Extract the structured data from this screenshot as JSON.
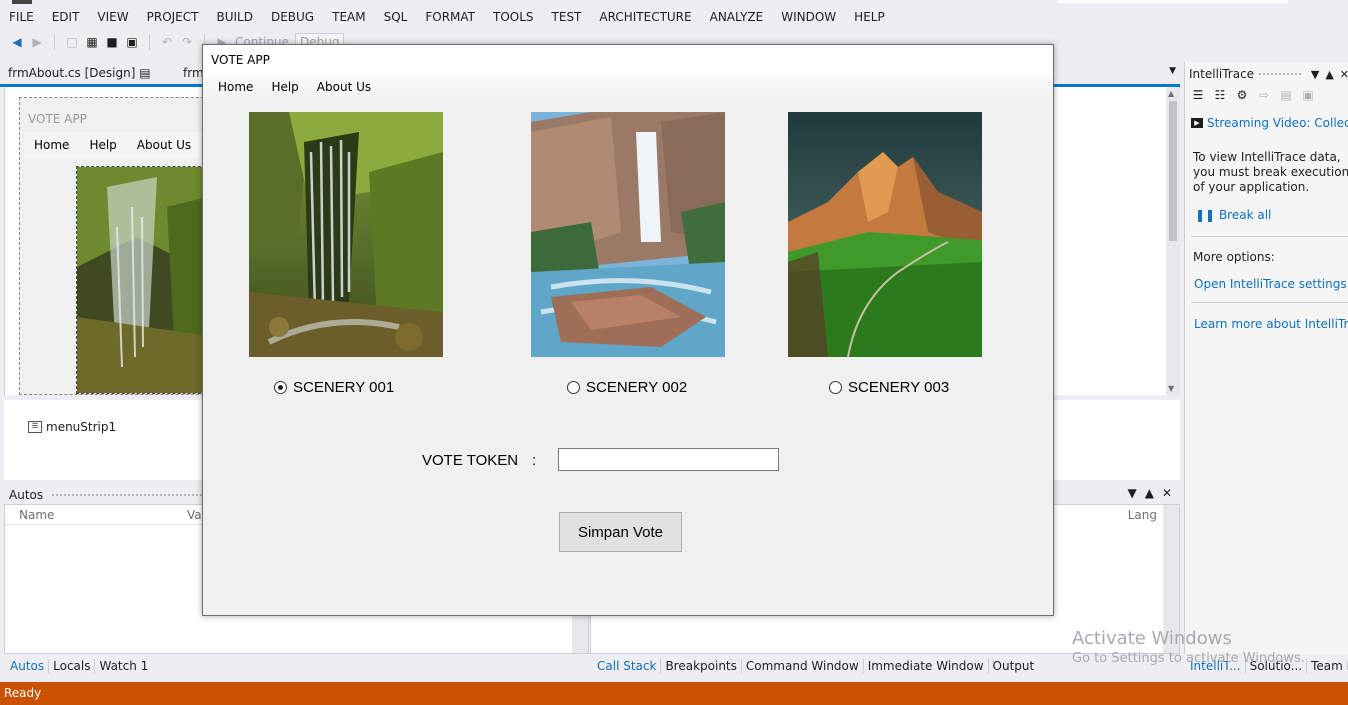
{
  "ide": {
    "menu": [
      "FILE",
      "EDIT",
      "VIEW",
      "PROJECT",
      "BUILD",
      "DEBUG",
      "TEAM",
      "SQL",
      "FORMAT",
      "TOOLS",
      "TEST",
      "ARCHITECTURE",
      "ANALYZE",
      "WINDOW",
      "HELP"
    ],
    "toolbar": {
      "continue_label": "Continue",
      "config_value": "Debug"
    },
    "doc_tabs": {
      "tab1": "frmAbout.cs [Design]",
      "tab1_icon": "pin-icon",
      "tab2": "frm"
    },
    "designer_form": {
      "title": "VOTE APP",
      "menu": [
        "Home",
        "Help",
        "About Us"
      ]
    },
    "tray": {
      "component": "menuStrip1"
    },
    "autos": {
      "title": "Autos",
      "col_name": "Name",
      "col_value": "Val"
    },
    "right_panel": {
      "col_lang": "Lang"
    },
    "bottom_tabs_left": [
      "Autos",
      "Locals",
      "Watch 1"
    ],
    "bottom_tabs_right": [
      "Call Stack",
      "Breakpoints",
      "Command Window",
      "Immediate Window",
      "Output"
    ],
    "bottom_tabs_side": [
      "IntelliT...",
      "Solutio...",
      "Team E..."
    ],
    "status": "Ready",
    "activate": {
      "line1": "Activate Windows",
      "line2": "Go to Settings to activate Windows."
    },
    "intellitrace": {
      "title": "IntelliTrace",
      "stream": "Streaming Video: Collect",
      "desc": "To view IntelliTrace data, you must break execution of your application.",
      "break_all": "Break all",
      "more_options": "More options:",
      "open_settings": "Open IntelliTrace settings",
      "learn_more": "Learn more about IntelliTrace"
    },
    "colors": {
      "accent": "#007acc",
      "status": "#ca5100",
      "link": "#0e70c0"
    }
  },
  "app": {
    "title": "VOTE APP",
    "menu": [
      "Home",
      "Help",
      "About Us"
    ],
    "options": [
      {
        "label": "SCENERY 001",
        "selected": true
      },
      {
        "label": "SCENERY 002",
        "selected": false
      },
      {
        "label": "SCENERY 003",
        "selected": false
      }
    ],
    "token_label": "VOTE TOKEN",
    "token_colon": ":",
    "token_value": "",
    "save_label": "Simpan Vote"
  }
}
